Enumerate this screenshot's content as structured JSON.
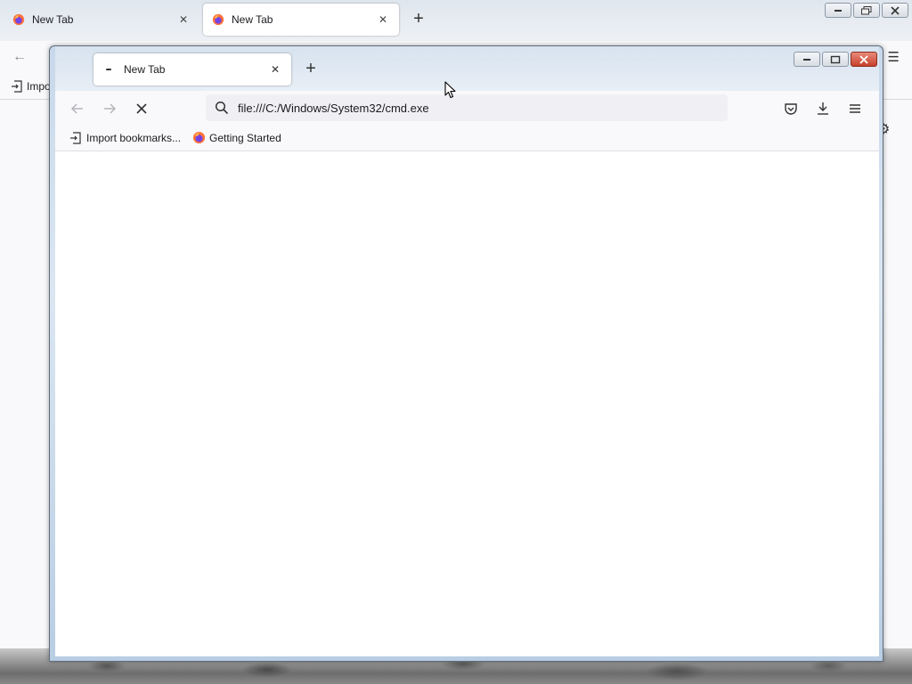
{
  "background_window": {
    "tabs": [
      {
        "label": "New Tab",
        "active": false
      },
      {
        "label": "New Tab",
        "active": true
      }
    ],
    "bookmark_partial": "Impo"
  },
  "foreground_window": {
    "tab": {
      "label": "New Tab"
    },
    "url": "file:///C:/Windows/System32/cmd.exe",
    "bookmarks": [
      {
        "label": "Import bookmarks...",
        "icon": "import-icon"
      },
      {
        "label": "Getting Started",
        "icon": "firefox-icon"
      }
    ]
  },
  "colors": {
    "accent_close": "#c7412c",
    "page_bg": "#ffffff",
    "toolbar_bg": "#f9f9fb"
  }
}
